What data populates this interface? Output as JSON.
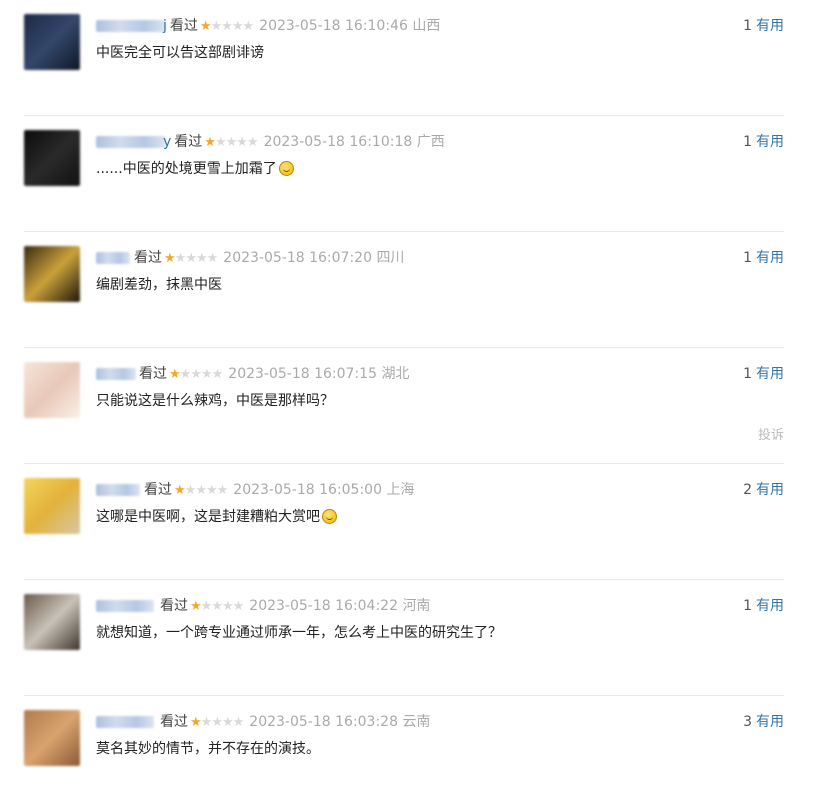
{
  "reviews": [
    {
      "watched": "看过",
      "time": "2023-05-18 16:10:46",
      "region": "山西",
      "content": "中医完全可以告这部剧诽谤",
      "useful_count": "1",
      "useful_label": "有用",
      "name_suffix": "j",
      "avatar_colors": [
        "#1c2a44",
        "#33476b",
        "#0f1727"
      ]
    },
    {
      "watched": "看过",
      "time": "2023-05-18 16:10:18",
      "region": "广西",
      "content": "......中医的处境更雪上加霜了",
      "emoji": "thinking-emoji",
      "useful_count": "1",
      "useful_label": "有用",
      "name_suffix": "y",
      "avatar_colors": [
        "#0b0b0b",
        "#2a2a2a",
        "#111111"
      ]
    },
    {
      "watched": "看过",
      "time": "2023-05-18 16:07:20",
      "region": "四川",
      "content": "编剧差劲，抹黑中医",
      "useful_count": "1",
      "useful_label": "有用",
      "name_suffix": "",
      "avatar_colors": [
        "#3a2b12",
        "#caa13a",
        "#1d1609"
      ]
    },
    {
      "watched": "看过",
      "time": "2023-05-18 16:07:15",
      "region": "湖北",
      "content": "只能说这是什么辣鸡，中医是那样吗？",
      "useful_count": "1",
      "useful_label": "有用",
      "report_label": "投诉",
      "name_suffix": "",
      "avatar_colors": [
        "#f4e6d8",
        "#e8c8b8",
        "#f9efe6"
      ]
    },
    {
      "watched": "看过",
      "time": "2023-05-18 16:05:00",
      "region": "上海",
      "content": "这哪是中医啊，这是封建糟粕大赏吧",
      "emoji": "grin-emoji",
      "useful_count": "2",
      "useful_label": "有用",
      "name_suffix": "",
      "avatar_colors": [
        "#f3d45a",
        "#e3b23b",
        "#d9c7a3"
      ]
    },
    {
      "watched": "看过",
      "time": "2023-05-18 16:04:22",
      "region": "河南",
      "content": "就想知道，一个跨专业通过师承一年，怎么考上中医的研究生了？",
      "useful_count": "1",
      "useful_label": "有用",
      "name_suffix": "",
      "avatar_colors": [
        "#6b5a4a",
        "#c9c2b8",
        "#3f362d"
      ]
    },
    {
      "watched": "看过",
      "time": "2023-05-18 16:03:28",
      "region": "云南",
      "content": "莫名其妙的情节，并不存在的演技。",
      "useful_count": "3",
      "useful_label": "有用",
      "name_suffix": "",
      "avatar_colors": [
        "#b07a4a",
        "#d9a36f",
        "#8a5a33"
      ]
    }
  ],
  "rating": {
    "stars_on": 1,
    "stars_total": 5
  },
  "colors": {
    "star_on": "#f5a623",
    "star_off": "#d9d9d9",
    "link": "#3377aa"
  }
}
